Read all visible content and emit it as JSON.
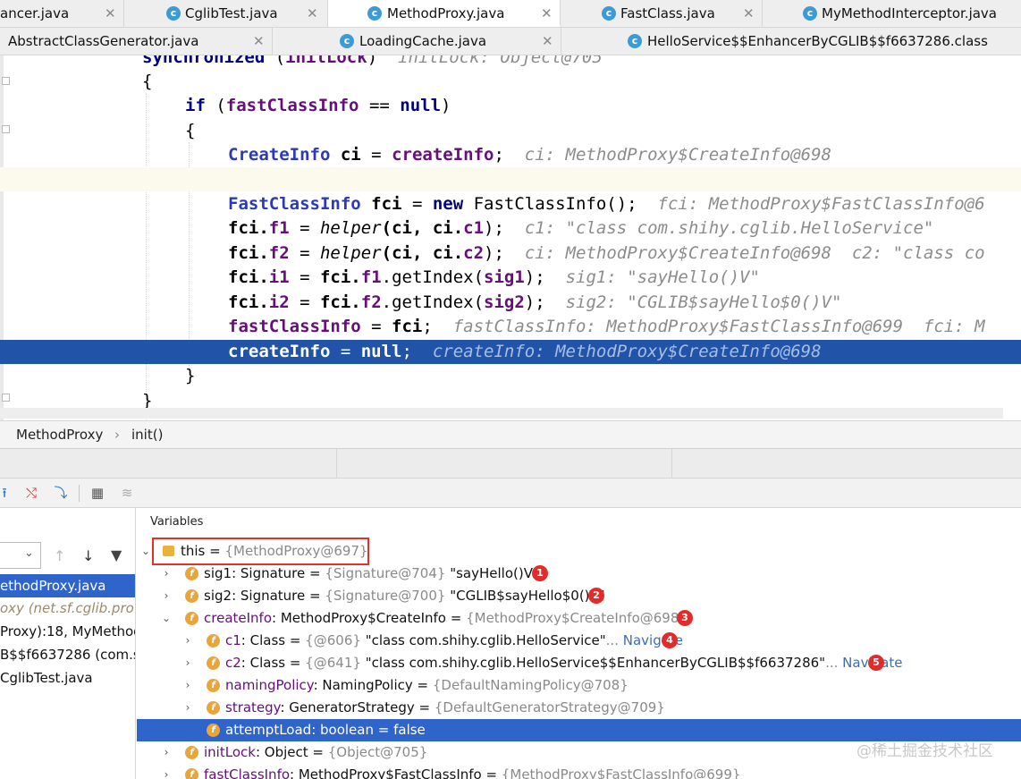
{
  "tabs_row1": [
    {
      "label": "ancer.java",
      "icon": "java-file-icon",
      "active": false
    },
    {
      "label": "CglibTest.java",
      "icon": "java-class-icon",
      "active": false
    },
    {
      "label": "MethodProxy.java",
      "icon": "java-class-icon",
      "active": true
    },
    {
      "label": "FastClass.java",
      "icon": "java-class-icon",
      "active": false
    },
    {
      "label": "MyMethodInterceptor.java",
      "icon": "java-class-icon",
      "active": false
    }
  ],
  "tabs_row2": [
    {
      "label": "AbstractClassGenerator.java",
      "icon": "java-class-icon"
    },
    {
      "label": "LoadingCache.java",
      "icon": "java-class-icon"
    },
    {
      "label": "HelloService$$EnhancerByCGLIB$$f6637286.class",
      "icon": "java-class-icon"
    }
  ],
  "code": {
    "l0": {
      "kw": "synchronized",
      "mid": " (",
      "fld": "initLock",
      "end": ")",
      "hint": "initLock: Object@705"
    },
    "l1": "{",
    "l2": {
      "kw": "if",
      "a": " (",
      "fld": "fastClassInfo",
      "b": " == ",
      "kw2": "null",
      "c": ")"
    },
    "l3": "{",
    "l4": {
      "type": "CreateInfo",
      "var": "ci",
      "eq": " = ",
      "val": "createInfo",
      "end": ";",
      "hint": "ci: MethodProxy$CreateInfo@698"
    },
    "l6": {
      "type": "FastClassInfo",
      "var": "fci",
      "eq": " = ",
      "kw": "new",
      "rest": " FastClassInfo();",
      "hint": "fci: MethodProxy$FastClassInfo@6"
    },
    "l7": {
      "lhs": "fci.",
      "f": "f1",
      "eq": " = ",
      "call": "helper",
      "args1": "(ci, ci.",
      "a": "c1",
      "end": ");",
      "hint": "c1: \"class com.shihy.cglib.HelloService\""
    },
    "l8": {
      "lhs": "fci.",
      "f": "f2",
      "eq": " = ",
      "call": "helper",
      "args1": "(ci, ci.",
      "a": "c2",
      "end": ");",
      "hint": "ci: MethodProxy$CreateInfo@698  c2: \"class co"
    },
    "l9": {
      "lhs": "fci.",
      "f": "i1",
      "eq": " = ",
      "mid": "fci.",
      "f2": "f1",
      "call": ".getIndex(",
      "a": "sig1",
      "end": ");",
      "hint": "sig1: \"sayHello()V\""
    },
    "l10": {
      "lhs": "fci.",
      "f": "i2",
      "eq": " = ",
      "mid": "fci.",
      "f2": "f2",
      "call": ".getIndex(",
      "a": "sig2",
      "end": ");",
      "hint": "sig2: \"CGLIB$sayHello$0()V\""
    },
    "l11": {
      "fld": "fastClassInfo",
      "eq": " = ",
      "val": "fci",
      "end": ";",
      "hint": "fastClassInfo: MethodProxy$FastClassInfo@699  fci: M"
    },
    "l12": {
      "fld": "createInfo",
      "eq": " = ",
      "kw": "null",
      "end": ";",
      "hint": "createInfo: MethodProxy$CreateInfo@698"
    },
    "l13": "}",
    "l14": "}"
  },
  "breadcrumb": {
    "class": "MethodProxy",
    "sep": "›",
    "method": "init()"
  },
  "frames": {
    "items": [
      {
        "text": "ethodProxy.java",
        "selected": true
      },
      {
        "text": "oxy (net.sf.cglib.pro",
        "selected": false,
        "gray": true
      },
      {
        "text": "Proxy):18, MyMethod",
        "selected": false
      },
      {
        "text": "B$$f6637286 (com.sh",
        "selected": false
      },
      {
        "text": " CglibTest.java",
        "selected": false
      }
    ]
  },
  "variables": {
    "header": "Variables",
    "this": {
      "name": "this",
      "eq": " = ",
      "val": "{MethodProxy@697}"
    },
    "rows": [
      {
        "name": "sig1",
        "type": ": Signature",
        "eq": "  = ",
        "ref": "{Signature@704}",
        "val": " \"sayHello()V\"",
        "badge": "1"
      },
      {
        "name": "sig2",
        "type": ": Signature",
        "eq": "  = ",
        "ref": "{Signature@700}",
        "val": " \"CGLIB$sayHello$0()V\"",
        "badge": "2"
      },
      {
        "name": "createInfo",
        "type": ": MethodProxy$CreateInfo",
        "eq": "  = ",
        "ref": "{MethodProxy$CreateInfo@698}",
        "val": "",
        "badge": "3"
      },
      {
        "name": "c1",
        "type": ": Class",
        "eq": "  = ",
        "ref": "{@606}",
        "val": " \"class com.shihy.cglib.HelloService\"",
        "more": "...",
        "nav": " Navigate",
        "badge": "4"
      },
      {
        "name": "c2",
        "type": ": Class",
        "eq": "  = ",
        "ref": "{@641}",
        "val": " \"class com.shihy.cglib.HelloService$$EnhancerByCGLIB$$f6637286\"",
        "more": "...",
        "nav": " Navigate",
        "badge": "5"
      },
      {
        "name": "namingPolicy",
        "type": ": NamingPolicy",
        "eq": "  = ",
        "ref": "{DefaultNamingPolicy@708}",
        "val": ""
      },
      {
        "name": "strategy",
        "type": ": GeneratorStrategy",
        "eq": "  = ",
        "ref": "{DefaultGeneratorStrategy@709}",
        "val": ""
      },
      {
        "name": "attemptLoad",
        "type": ": boolean",
        "eq": "  = ",
        "ref": "",
        "val": "false"
      },
      {
        "name": "initLock",
        "type": ": Object",
        "eq": "  = ",
        "ref": "{Object@705}",
        "val": ""
      },
      {
        "name": "fastClassInfo",
        "type": ": MethodProxy$FastClassInfo",
        "eq": "  = ",
        "ref": "{MethodProxy$FastClassInfo@699}",
        "val": ""
      }
    ]
  },
  "watermark": "@稀土掘金技术社区",
  "colors": {
    "selection": "#2154a8",
    "list_selection": "#2f65ca",
    "badge": "#e22b2b",
    "field_icon": "#e8a53c",
    "keyword": "#000080",
    "field": "#660e7a"
  }
}
